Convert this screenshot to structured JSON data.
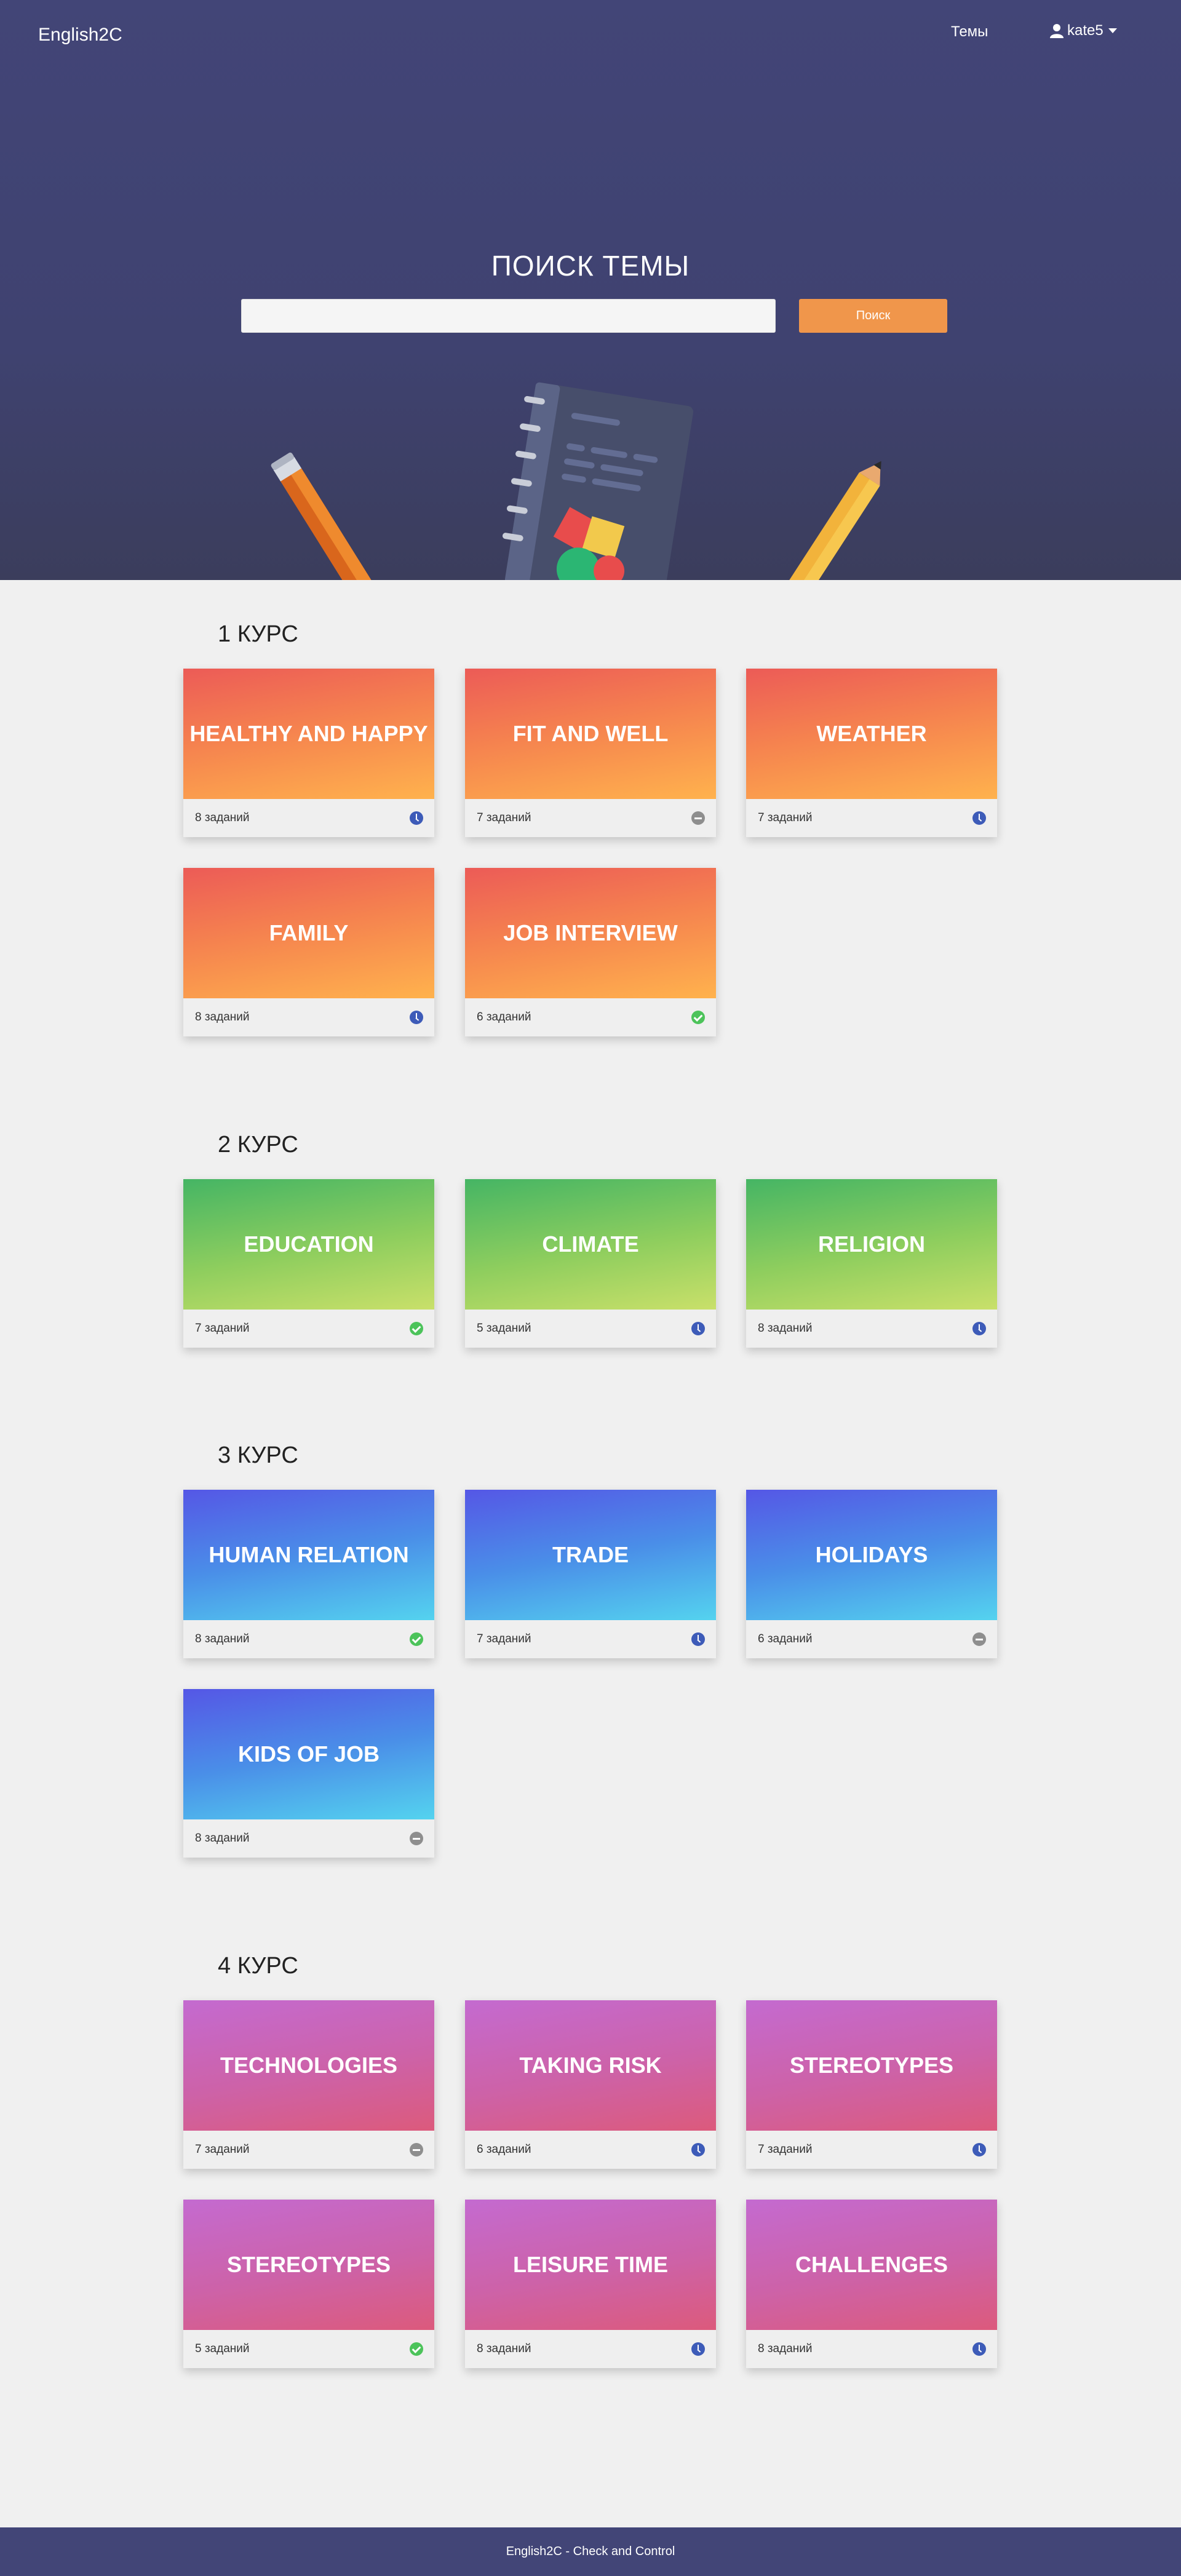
{
  "header": {
    "brand": "English2C",
    "nav_topics": "Темы",
    "user": "kate5"
  },
  "hero": {
    "title": "ПОИСК ТЕМЫ",
    "search_placeholder": "",
    "search_value": "",
    "search_button": "Поиск"
  },
  "courses": [
    {
      "title": "1 КУРС",
      "cards": [
        {
          "title": "HEALTHY AND HAPPY",
          "tasks": "8 заданий",
          "status": "in-progress"
        },
        {
          "title": "FIT AND WELL",
          "tasks": "7 заданий",
          "status": "locked"
        },
        {
          "title": "WEATHER",
          "tasks": "7 заданий",
          "status": "in-progress"
        },
        {
          "title": "FAMILY",
          "tasks": "8 заданий",
          "status": "in-progress"
        },
        {
          "title": "JOB INTERVIEW",
          "tasks": "6 заданий",
          "status": "done"
        }
      ]
    },
    {
      "title": "2 КУРС",
      "cards": [
        {
          "title": "EDUCATION",
          "tasks": "7 заданий",
          "status": "done"
        },
        {
          "title": "CLIMATE",
          "tasks": "5 заданий",
          "status": "in-progress"
        },
        {
          "title": "RELIGION",
          "tasks": "8 заданий",
          "status": "in-progress"
        }
      ]
    },
    {
      "title": "3 КУРС",
      "cards": [
        {
          "title": "HUMAN RELATION",
          "tasks": "8 заданий",
          "status": "done"
        },
        {
          "title": "TRADE",
          "tasks": "7 заданий",
          "status": "in-progress"
        },
        {
          "title": "HOLIDAYS",
          "tasks": "6 заданий",
          "status": "locked"
        },
        {
          "title": "KIDS OF JOB",
          "tasks": "8 заданий",
          "status": "locked"
        }
      ]
    },
    {
      "title": "4 КУРС",
      "cards": [
        {
          "title": "TECHNOLOGIES",
          "tasks": "7 заданий",
          "status": "locked"
        },
        {
          "title": "TAKING RISK",
          "tasks": "6 заданий",
          "status": "in-progress"
        },
        {
          "title": "STEREOTYPES",
          "tasks": "7 заданий",
          "status": "in-progress"
        },
        {
          "title": "STEREOTYPES",
          "tasks": "5 заданий",
          "status": "done"
        },
        {
          "title": "LEISURE TIME",
          "tasks": "8 заданий",
          "status": "in-progress"
        },
        {
          "title": "CHALLENGES",
          "tasks": "8 заданий",
          "status": "in-progress"
        }
      ]
    }
  ],
  "footer": {
    "text": "English2C - Check and Control"
  }
}
